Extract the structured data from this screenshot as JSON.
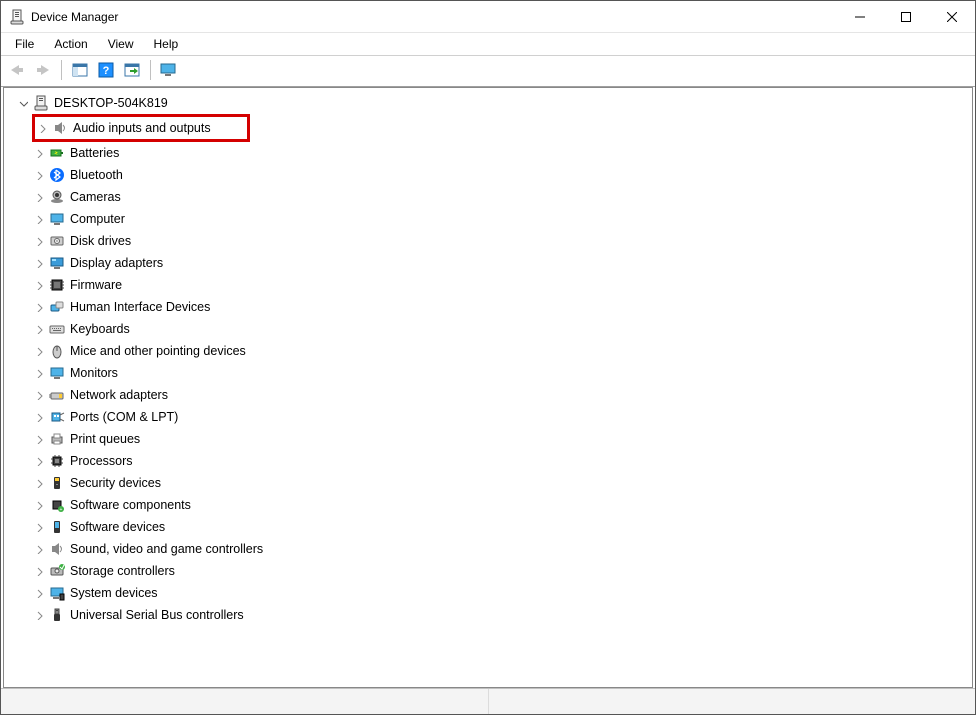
{
  "window": {
    "title": "Device Manager"
  },
  "menu": {
    "items": [
      "File",
      "Action",
      "View",
      "Help"
    ]
  },
  "tree": {
    "root": {
      "label": "DESKTOP-504K819",
      "expanded": true
    },
    "categories": [
      {
        "label": "Audio inputs and outputs",
        "icon": "speaker",
        "highlighted": true
      },
      {
        "label": "Batteries",
        "icon": "battery"
      },
      {
        "label": "Bluetooth",
        "icon": "bluetooth"
      },
      {
        "label": "Cameras",
        "icon": "camera"
      },
      {
        "label": "Computer",
        "icon": "computer"
      },
      {
        "label": "Disk drives",
        "icon": "disk"
      },
      {
        "label": "Display adapters",
        "icon": "display"
      },
      {
        "label": "Firmware",
        "icon": "firmware"
      },
      {
        "label": "Human Interface Devices",
        "icon": "hid"
      },
      {
        "label": "Keyboards",
        "icon": "keyboard"
      },
      {
        "label": "Mice and other pointing devices",
        "icon": "mouse"
      },
      {
        "label": "Monitors",
        "icon": "monitor"
      },
      {
        "label": "Network adapters",
        "icon": "network"
      },
      {
        "label": "Ports (COM & LPT)",
        "icon": "port"
      },
      {
        "label": "Print queues",
        "icon": "printer"
      },
      {
        "label": "Processors",
        "icon": "cpu"
      },
      {
        "label": "Security devices",
        "icon": "security"
      },
      {
        "label": "Software components",
        "icon": "sw-component"
      },
      {
        "label": "Software devices",
        "icon": "sw-device"
      },
      {
        "label": "Sound, video and game controllers",
        "icon": "sound"
      },
      {
        "label": "Storage controllers",
        "icon": "storage"
      },
      {
        "label": "System devices",
        "icon": "system"
      },
      {
        "label": "Universal Serial Bus controllers",
        "icon": "usb"
      }
    ]
  }
}
